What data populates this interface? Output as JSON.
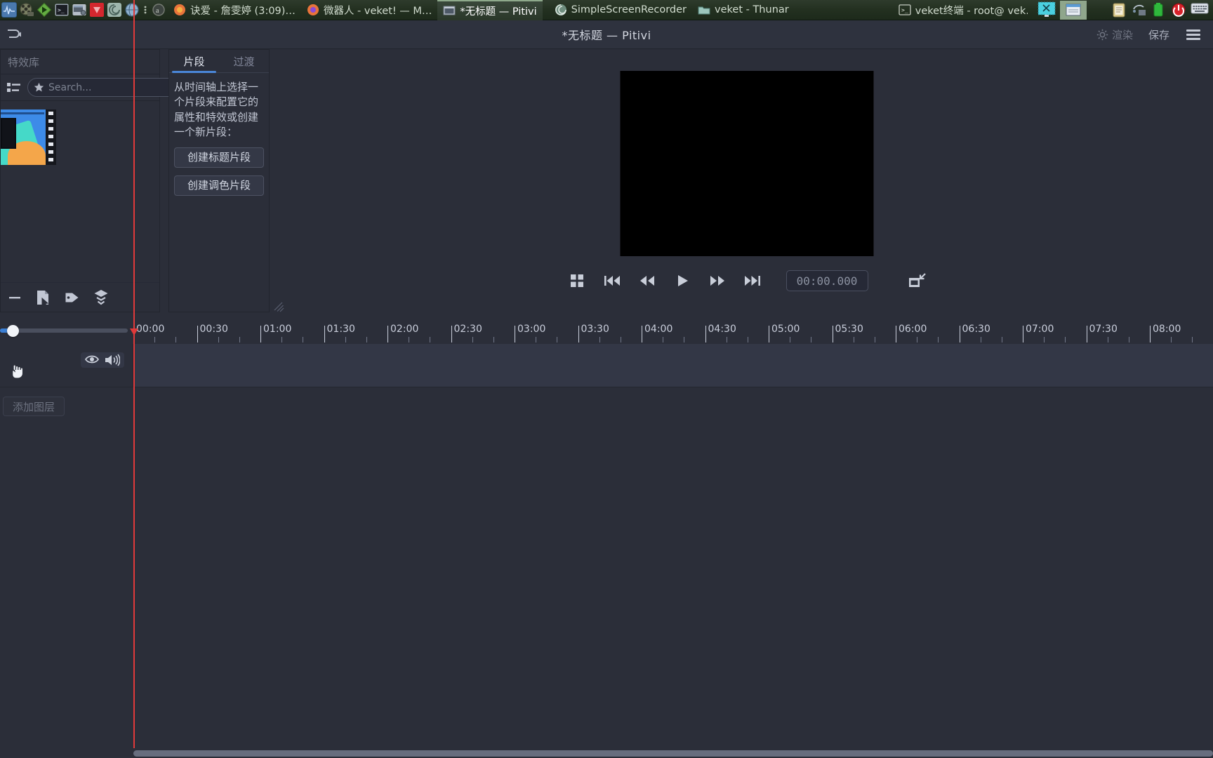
{
  "taskbar": {
    "launcher_icons": [
      {
        "name": "audio-wave-icon",
        "color": "#3e6fa8"
      },
      {
        "name": "film-reel-icon",
        "color": "#6b6f5a"
      },
      {
        "name": "green-play-icon",
        "color": "#5aa23b"
      },
      {
        "name": "terminal-icon",
        "color": "#3c4450"
      },
      {
        "name": "screenshot-icon",
        "color": "#9aa3ad"
      },
      {
        "name": "ruby-gem-icon",
        "color": "#d4272e"
      },
      {
        "name": "spiral-galaxy-icon",
        "color": "#9fb7ae"
      },
      {
        "name": "globe-browser-icon",
        "color": "#8fa8c4"
      },
      {
        "name": "menu-dots-icon",
        "color": "#2a3629"
      },
      {
        "name": "opera-circle-icon",
        "color": "#4a4f46"
      }
    ],
    "tasks": [
      {
        "name": "task-music-player",
        "label": "诀爱 - 詹雯婷 (3:09)…",
        "icon": "firefox-icon",
        "active": false
      },
      {
        "name": "task-browser",
        "label": "微器人 - veket! — M…",
        "icon": "window-icon",
        "active": false
      },
      {
        "name": "task-pitivi",
        "label": "*无标题 — Pitivi",
        "icon": "pitivi-icon",
        "active": true
      },
      {
        "name": "task-recorder",
        "label": "SimpleScreenRecorder",
        "icon": "recorder-icon",
        "active": false
      },
      {
        "name": "task-thunar",
        "label": "veket - Thunar",
        "icon": "folder-icon",
        "active": false
      },
      {
        "name": "task-terminal",
        "label": "veket终端 - root@ vek…",
        "icon": "terminal-icon",
        "active": false
      }
    ],
    "windows": [
      {
        "name": "window-button-scissors",
        "selected": false
      },
      {
        "name": "window-button-notepad",
        "selected": true
      }
    ],
    "tray_icons": [
      {
        "name": "clipboard-icon",
        "color": "#d9c98a"
      },
      {
        "name": "network-icon",
        "color": "#7d8a97"
      },
      {
        "name": "battery-icon",
        "color": "#3fbf4a"
      },
      {
        "name": "power-icon",
        "color": "#d8222a"
      },
      {
        "name": "keyboard-icon",
        "color": "#dfe3ea"
      }
    ]
  },
  "header": {
    "title": "*无标题 — Pitivi",
    "back_icon": "undo-arrow-icon",
    "render_label": "渲染",
    "render_icon": "gear-icon",
    "save_label": "保存",
    "menu_icon": "hamburger-menu-icon"
  },
  "library": {
    "title": "特效库",
    "view_toggle_icon": "list-view-icon",
    "search": {
      "placeholder": "Search...",
      "value": "",
      "star_icon": "star-icon",
      "clear_icon": "clear-backspace-icon"
    },
    "items": [
      {
        "name": "media-clip-thumbnail",
        "label": ""
      }
    ],
    "toolbar": [
      {
        "name": "remove-clip-button",
        "icon": "minus-icon"
      },
      {
        "name": "clip-properties-button",
        "icon": "document-cursor-icon"
      },
      {
        "name": "tag-button",
        "icon": "tag-icon"
      },
      {
        "name": "layers-button",
        "icon": "layers-chevron-icon"
      }
    ]
  },
  "clip_properties": {
    "tabs": [
      {
        "name": "tab-clip",
        "label": "片段",
        "active": true
      },
      {
        "name": "tab-transition",
        "label": "过渡",
        "active": false
      }
    ],
    "description": "从时间轴上选择一个片段来配置它的属性和特效或创建一个新片段：",
    "buttons": [
      {
        "name": "create-title-clip-button",
        "label": "创建标题片段"
      },
      {
        "name": "create-color-clip-button",
        "label": "创建调色片段"
      }
    ],
    "resize_grip_icon": "resize-grip-icon"
  },
  "viewer": {
    "video_background": "#000000",
    "transport": [
      {
        "name": "view-mode-button",
        "icon": "grid-squares-icon"
      },
      {
        "name": "go-to-start-button",
        "icon": "skip-to-start-icon"
      },
      {
        "name": "rewind-button",
        "icon": "rewind-icon"
      },
      {
        "name": "play-button",
        "icon": "play-icon"
      },
      {
        "name": "fast-forward-button",
        "icon": "fast-forward-icon"
      },
      {
        "name": "go-to-end-button",
        "icon": "skip-to-end-icon"
      }
    ],
    "timecode": "00:00.000",
    "collapse_icon": "undock-viewer-icon"
  },
  "timeline": {
    "zoom_slider": {
      "name": "zoom-slider",
      "value": 8
    },
    "ruler": {
      "labels": [
        "00:00",
        "00:30",
        "01:00",
        "01:30",
        "02:00",
        "02:30",
        "03:00",
        "03:30",
        "04:00",
        "04:30",
        "05:00",
        "05:30",
        "06:00",
        "06:30",
        "07:00",
        "07:30",
        "08:00"
      ],
      "interval_seconds": 30,
      "pixels_per_label": 90.5
    },
    "playhead_position": "00:00.000",
    "layer": {
      "visibility_icon": "eye-icon",
      "audio_icon": "speaker-icon",
      "cursor_icon": "hand-pointer-icon"
    },
    "add_layer_label": "添加图层",
    "clips": []
  },
  "colors": {
    "window_bg": "#2b2e39",
    "panel_bg": "#2e323e",
    "accent_blue": "#4a86d8",
    "playhead_red": "#e03a3a",
    "taskbar_green": "#233020",
    "text_primary": "#d3d7e0",
    "text_dim": "#787d8b"
  }
}
